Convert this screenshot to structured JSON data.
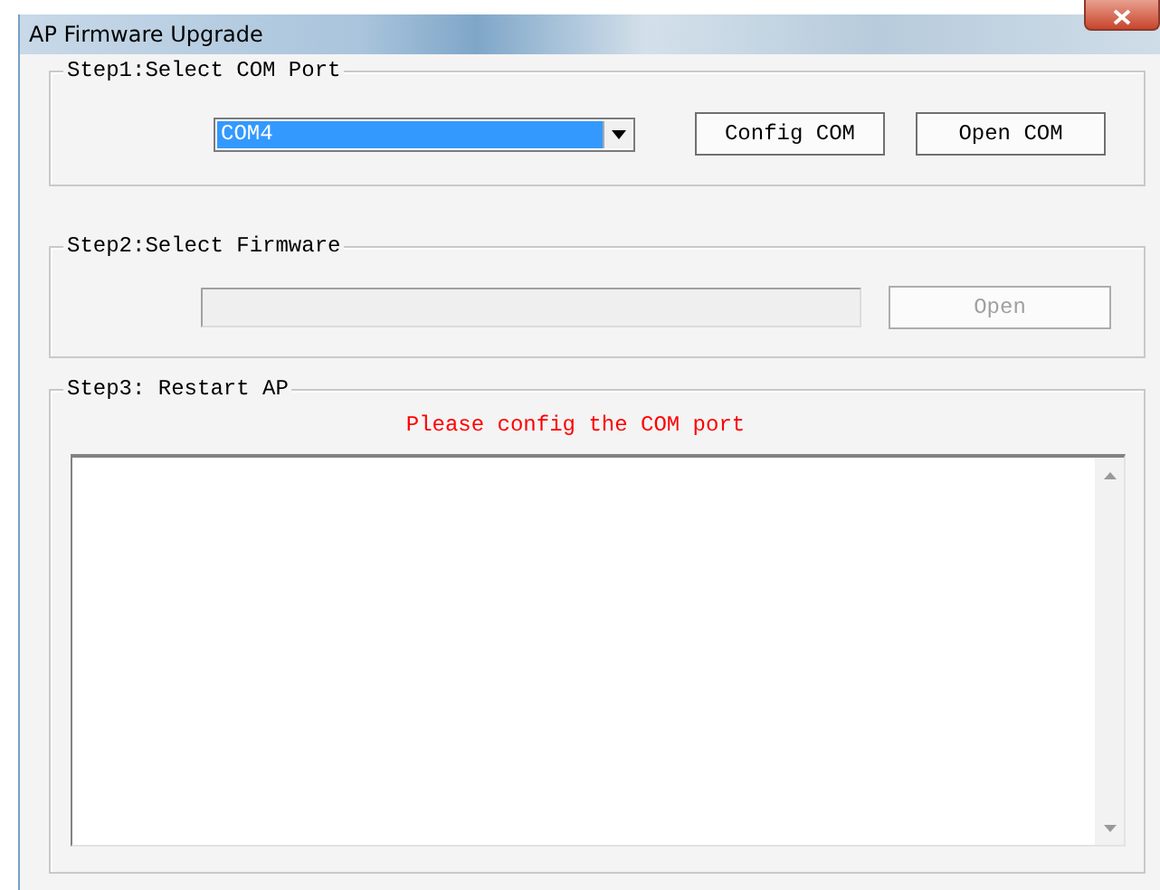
{
  "window": {
    "title": "AP Firmware Upgrade"
  },
  "step1": {
    "legend": "Step1:Select COM Port",
    "port": {
      "value": "COM4",
      "selected": true
    },
    "buttons": [
      {
        "label": "Config COM",
        "disabled": false
      },
      {
        "label": "Open COM",
        "disabled": false
      }
    ]
  },
  "step2": {
    "legend": "Step2:Select Firmware",
    "file_field": {
      "disabled": true
    },
    "button": {
      "label": "Open",
      "disabled": true
    }
  },
  "step3": {
    "legend": "Step3: Restart AP",
    "message": "Please config the COM port"
  }
}
